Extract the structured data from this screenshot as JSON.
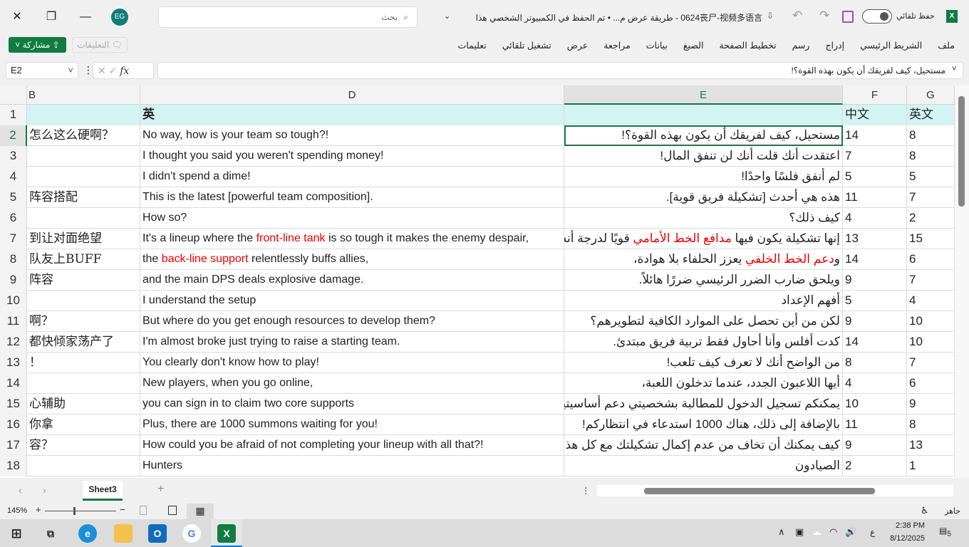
{
  "window": {
    "title": "0624丧尸-视频多语言  -  طريقة عرض م... • تم الحفظ في الكمبيوتر الشخصي هذا",
    "autosave_label": "حفظ تلقائي",
    "user_initials": "EG",
    "search_placeholder": "بحث"
  },
  "ribbon": {
    "tabs": [
      "ملف",
      "الشريط الرئيسي",
      "إدراج",
      "رسم",
      "تخطيط الصفحة",
      "الصيغ",
      "بيانات",
      "مراجعة",
      "عرض",
      "تشغيل تلقائي",
      "تعليمات"
    ],
    "share_label": "مشاركة",
    "comments_label": "التعليقات"
  },
  "formula_bar": {
    "name_box": "E2",
    "fx": "fx",
    "value": "مستحيل، كيف لفريقك أن يكون بهذه القوة؟!"
  },
  "columns": [
    "B",
    "D",
    "E",
    "F",
    "G"
  ],
  "rows": [
    {
      "n": "1",
      "b": "",
      "d": "英",
      "e": "",
      "f": "中文",
      "g": "英文"
    },
    {
      "n": "2",
      "b": "怎么这么硬啊？",
      "d": "No way, how is your team so tough?!",
      "e": "مستحيل، كيف لفريقك أن يكون بهذه القوة؟!",
      "f": "14",
      "g": "8"
    },
    {
      "n": "3",
      "b": "",
      "d": "I thought you said you weren't spending money!",
      "e": "اعتقدت أنك قلت أنك لن تنفق المال!",
      "f": "7",
      "g": "8"
    },
    {
      "n": "4",
      "b": "",
      "d": "I didn't spend a dime!",
      "e": "لم أنفق فلسًا واحدًا!",
      "f": "5",
      "g": "5"
    },
    {
      "n": "5",
      "b": "阵容搭配",
      "d": "This is the latest [powerful team composition].",
      "e": "هذه هي أحدث [تشكيلة فريق قوية].",
      "f": "11",
      "g": "7"
    },
    {
      "n": "6",
      "b": "",
      "d": "How so?",
      "e": "كيف ذلك؟",
      "f": "4",
      "g": "2"
    },
    {
      "n": "7",
      "b": "到让对面绝望",
      "d": "It's a lineup where the ",
      "d_red": "front-line tank",
      "d_post": " is so tough it makes the enemy despair,",
      "e": "إنها تشكيلة يكون فيها ",
      "e_red": "مدافع الخط الأمامي",
      "e_post": " قويًا لدرجة أنه",
      "f": "13",
      "g": "15"
    },
    {
      "n": "8",
      "b": "队友上BUFF",
      "d": "the ",
      "d_red": "back-line support",
      "d_post": " relentlessly buffs allies,",
      "e": "و",
      "e_red": "دعم الخط الخلفي",
      "e_post": " يعزز الحلفاء بلا هوادة،",
      "f": "14",
      "g": "6"
    },
    {
      "n": "9",
      "b": "阵容",
      "d": "and the main DPS deals explosive damage.",
      "e": "ويلحق ضارب الضرر الرئيسي ضررًا هائلاً.",
      "f": "9",
      "g": "7"
    },
    {
      "n": "10",
      "b": "",
      "d": "I understand the setup",
      "e": "أفهم الإعداد",
      "f": "5",
      "g": "4"
    },
    {
      "n": "11",
      "b": "啊？",
      "d": "But where do you get enough resources to develop them?",
      "e": "لكن من أين تحصل على الموارد الكافية لتطويرهم؟",
      "f": "9",
      "g": "10"
    },
    {
      "n": "12",
      "b": "都快倾家荡产了",
      "d": "I'm almost broke just trying to raise a starting team.",
      "e": "كدت أفلس وأنا أحاول فقط تربية فريق مبتدئ.",
      "f": "14",
      "g": "10"
    },
    {
      "n": "13",
      "b": "！",
      "d": "You clearly don't know how to play!",
      "e": "من الواضح أنك لا تعرف كيف تلعب!",
      "f": "8",
      "g": "7"
    },
    {
      "n": "14",
      "b": "",
      "d": "New players, when you go online,",
      "e": "أيها اللاعبون الجدد، عندما تدخلون اللعبة،",
      "f": "4",
      "g": "6"
    },
    {
      "n": "15",
      "b": "心辅助",
      "d": "you can sign in to claim two core supports",
      "e": "يمكنكم تسجيل الدخول للمطالبة بشخصيتي دعم أساسيتين",
      "f": "10",
      "g": "9"
    },
    {
      "n": "16",
      "b": "你拿",
      "d": "Plus, there are 1000 summons waiting for you!",
      "e": "بالإضافة إلى ذلك، هناك 1000 استدعاء في انتظاركم!",
      "f": "11",
      "g": "8"
    },
    {
      "n": "17",
      "b": "容？",
      "d": "How could you be afraid of not completing your lineup with all that?!",
      "e": "كيف يمكنك أن تخاف من عدم إكمال تشكيلتك مع كل هذا",
      "f": "9",
      "g": "13"
    },
    {
      "n": "18",
      "b": "",
      "d": "Hunters",
      "e": "الصيادون",
      "f": "2",
      "g": "1"
    }
  ],
  "sheets": {
    "active": "Sheet3"
  },
  "status": {
    "ready": "جاهز",
    "zoom": "145%"
  },
  "taskbar": {
    "time": "2:38 PM",
    "date": "8/12/2025",
    "lang": "ع",
    "notifications": "5"
  },
  "colors": {
    "accent": "#107c41",
    "header_fill": "#d4f3f3",
    "highlight_text": "#ee0000"
  }
}
